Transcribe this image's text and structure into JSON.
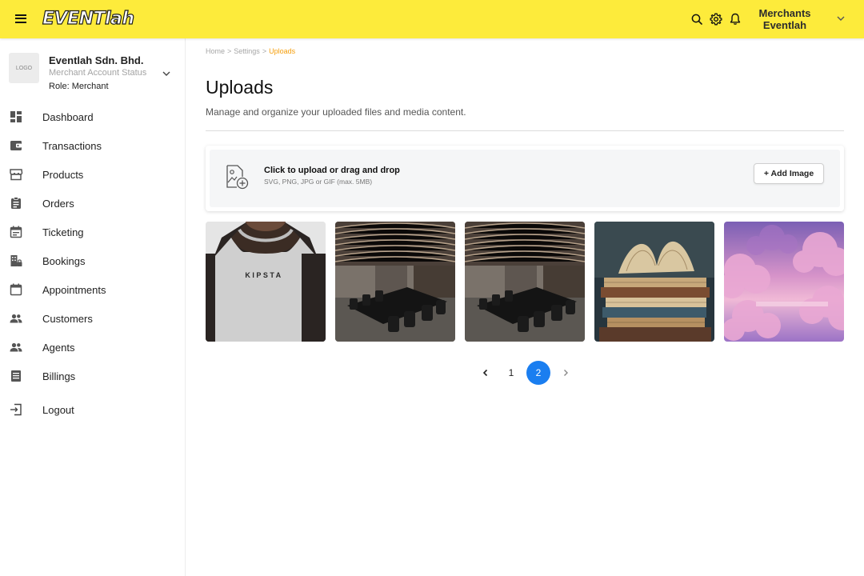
{
  "topbar": {
    "brand": "EVENTlah",
    "user_name": "Merchants Eventlah",
    "icons": [
      "menu-icon",
      "search-icon",
      "gear-icon",
      "bell-icon",
      "chevron-down-icon"
    ],
    "bg_color": "#fdeb3b"
  },
  "sidebar": {
    "merchant": {
      "logo_text": "LOGO",
      "name": "Eventlah Sdn. Bhd.",
      "status": "Merchant Account Status",
      "role": "Role: Merchant"
    },
    "items": [
      {
        "label": "Dashboard",
        "icon": "dashboard-icon"
      },
      {
        "label": "Transactions",
        "icon": "wallet-icon"
      },
      {
        "label": "Products",
        "icon": "store-icon"
      },
      {
        "label": "Orders",
        "icon": "clipboard-icon"
      },
      {
        "label": "Ticketing",
        "icon": "calendar-icon"
      },
      {
        "label": "Bookings",
        "icon": "building-lock-icon"
      },
      {
        "label": "Appointments",
        "icon": "calendar-blank-icon"
      },
      {
        "label": "Customers",
        "icon": "people-icon"
      },
      {
        "label": "Agents",
        "icon": "people-icon"
      },
      {
        "label": "Billings",
        "icon": "receipt-icon"
      }
    ],
    "logout": {
      "label": "Logout",
      "icon": "logout-icon"
    }
  },
  "main": {
    "breadcrumb": [
      "Home",
      "Settings",
      "Uploads"
    ],
    "breadcrumb_sep": ">",
    "title": "Uploads",
    "description": "Manage and organize your uploaded files and media content.",
    "upload": {
      "title": "Click to upload or drag and drop",
      "hint": "SVG, PNG, JPG or GIF (max. 5MB)",
      "button": "+ Add Image"
    },
    "images": [
      {
        "name": "jersey-image",
        "shirt_text": "KIPSTA"
      },
      {
        "name": "boardroom-image-1"
      },
      {
        "name": "boardroom-image-2"
      },
      {
        "name": "books-image"
      },
      {
        "name": "clouds-image"
      }
    ],
    "pagination": {
      "prev": "‹",
      "pages": [
        "1",
        "2"
      ],
      "current": "2",
      "next": "›"
    },
    "accent_color": "#1a7ef0",
    "breadcrumb_active_color": "#f59e0b"
  }
}
